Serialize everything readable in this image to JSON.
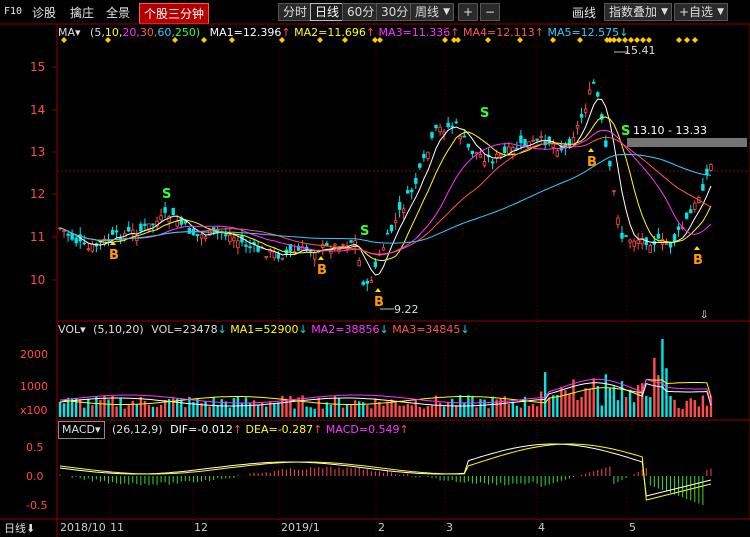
{
  "toolbar": {
    "f10": "F10",
    "diagnose": "诊股",
    "trade": "擒庄",
    "panorama": "全景",
    "stock_minute": "个股三分钟",
    "period_tabs": [
      "分时",
      "日线",
      "60分",
      "30分"
    ],
    "period_dropdown": "周线",
    "plus": "+",
    "minus": "−",
    "line_type": "画线",
    "index_overlay": "指数叠加",
    "add_watch": "+自选"
  },
  "ma_header": {
    "label": "MA",
    "params_prefix": "(5,",
    "p10": "10,",
    "p20": "20,",
    "p30": "30,",
    "p60": "60,",
    "p250": "250)",
    "ma1": "MA1=12.396",
    "ma2": "MA2=11.696",
    "ma3": "MA3=11.336",
    "ma4": "MA4=12.113",
    "ma5": "MA5=12.575"
  },
  "colors": {
    "ma5": "#ffffff",
    "ma10": "#ffff00",
    "ma20": "#ff33ff",
    "ma30": "#ff5555",
    "ma60": "#33ccff",
    "up": "#ff4b4b",
    "down": "#00e5e5",
    "grid_red": "#7a0000",
    "buy": "#ff9900",
    "sell": "#33ff33"
  },
  "price_axis": [
    "15",
    "14",
    "13",
    "12",
    "11",
    "10"
  ],
  "annotations": {
    "high": "15.41",
    "low": "9.22",
    "range": "13.10 - 13.33",
    "sell_mark": "S",
    "buy_mark": "B"
  },
  "vol_header": {
    "label": "VOL",
    "params": "(5,10,20)",
    "vol": "VOL=23478",
    "ma1": "MA1=52900",
    "ma2": "MA2=38856",
    "ma3": "MA3=34845"
  },
  "vol_axis": [
    "2000",
    "1000",
    "x100"
  ],
  "macd_header": {
    "label": "MACD",
    "params": "(26,12,9)",
    "dif": "DIF=-0.012",
    "dea": "DEA=-0.287",
    "macd": "MACD=0.549"
  },
  "macd_axis": [
    "0.5",
    "0.0",
    "-0.5"
  ],
  "bottom": {
    "period_label": "日线",
    "dates": [
      "2018/10",
      "11",
      "12",
      "2019/1",
      "2",
      "3",
      "4",
      "5"
    ]
  }
}
